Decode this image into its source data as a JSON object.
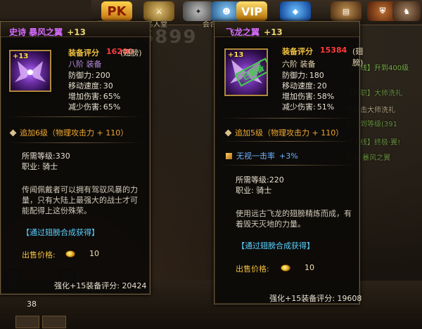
{
  "background": {
    "score_ghost": "26899",
    "topbar_labels": [
      "PK",
      "VIP"
    ],
    "topbar_sublabels": [
      "熙熙来袭",
      "名人堂",
      "会合",
      "管理时"
    ],
    "chat_log": [
      {
        "text": "【主线】升到400级",
        "color": "#7ab04a"
      },
      {
        "text": "【转职】大师洗礼",
        "color": "#6a9040"
      },
      {
        "text": "已被击大师洗礼",
        "color": "#b0a080"
      },
      {
        "text": "已达到等级(391",
        "color": "#6a9040"
      },
      {
        "text": "【支线】终极·翼!",
        "color": "#6a9040"
      },
      {
        "text": "穿戴 暴风之翼",
        "color": "#6a9040"
      }
    ],
    "bottom_count": "38"
  },
  "left_tooltip": {
    "title": "史诗 暴风之翼",
    "title_plus": "+13",
    "icon_plus": "+13",
    "rating_label": "装备评分",
    "rating_value": "16200",
    "slot": "(翅膀)",
    "tier": "八阶 装备",
    "stats": [
      {
        "label": "防御力:",
        "value": "200"
      },
      {
        "label": "移动速度:",
        "value": "30"
      },
      {
        "label": "增加伤害:",
        "value": "65%"
      },
      {
        "label": "减少伤害:",
        "value": "65%"
      }
    ],
    "enhance": "追加6级（物理攻击力 + 110）",
    "req_level": "所需等级:330",
    "req_class": "职业: 骑士",
    "description": "传闻佩戴者可以拥有驾驭风暴的力量，只有大陆上最强大的战士才可能配得上这份殊荣。",
    "source": "【通过翅膀合成获得】",
    "price_label": "出售价格:",
    "price_value": "10",
    "enhance_rating": "强化+15装备评分: 20424"
  },
  "right_tooltip": {
    "title": "飞龙之翼",
    "title_plus": "+13",
    "icon_plus": "+13",
    "stamp": "已装备",
    "rating_label": "装备评分",
    "rating_value": "15384",
    "slot": "(翅膀)",
    "tier": "六阶 装备",
    "stats": [
      {
        "label": "防御力:",
        "value": "180"
      },
      {
        "label": "移动速度:",
        "value": "20"
      },
      {
        "label": "增加伤害:",
        "value": "58%"
      },
      {
        "label": "减少伤害:",
        "value": "51%"
      }
    ],
    "enhance": "追加5级（物理攻击力 + 110）",
    "extra_attr": "无视一击率",
    "extra_pct": "+3%",
    "req_level": "所需等级:220",
    "req_class": "职业: 骑士",
    "description": "使用远古飞龙的翅膀精炼而成，有着毁天灭地的力量。",
    "source": "【通过翅膀合成获得】",
    "price_label": "出售价格:",
    "price_value": "10",
    "enhance_rating": "强化+15装备评分: 19608"
  },
  "colors": {
    "title_purple": "#d66bff",
    "rating_red": "#ff3a3a",
    "gold": "#f0c040",
    "enhance_orange": "#f0a830",
    "link_cyan": "#5ad0ff",
    "equipped_green": "#3fd04a"
  }
}
